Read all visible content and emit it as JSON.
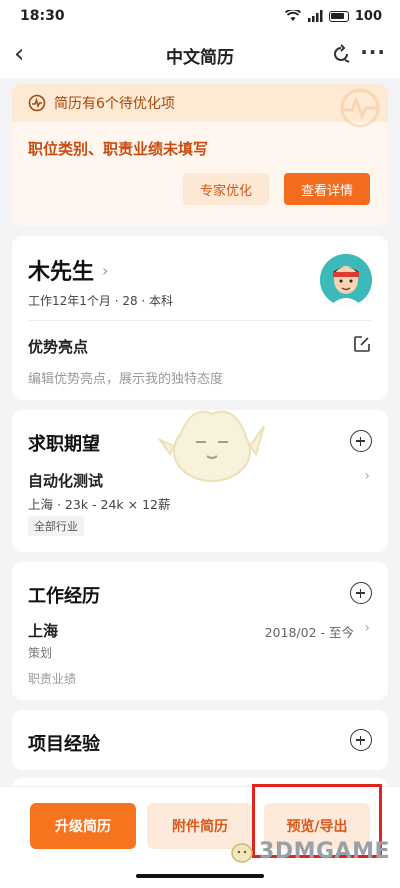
{
  "status": {
    "time": "18:30",
    "battery": "100"
  },
  "nav": {
    "title": "中文简历"
  },
  "optimize": {
    "header": "简历有6个待优化项",
    "message": "职位类别、职责业绩未填写",
    "expert_btn": "专家优化",
    "detail_btn": "查看详情"
  },
  "profile": {
    "name": "木先生",
    "meta": "工作12年1个月 · 28 · 本科",
    "advantage_title": "优势亮点",
    "advantage_hint": "编辑优势亮点，展示我的独特态度"
  },
  "expectation": {
    "title": "求职期望",
    "job": "自动化测试",
    "detail": "上海 · 23k - 24k × 12薪",
    "tag": "全部行业"
  },
  "work": {
    "title": "工作经历",
    "company": "上海",
    "date": "2018/02 - 至今",
    "role": "策划",
    "duty": "职责业绩"
  },
  "project": {
    "title": "项目经验"
  },
  "bottom": {
    "upgrade": "升级简历",
    "attachment": "附件简历",
    "export": "预览/导出"
  },
  "watermark": "3DMGAME"
}
